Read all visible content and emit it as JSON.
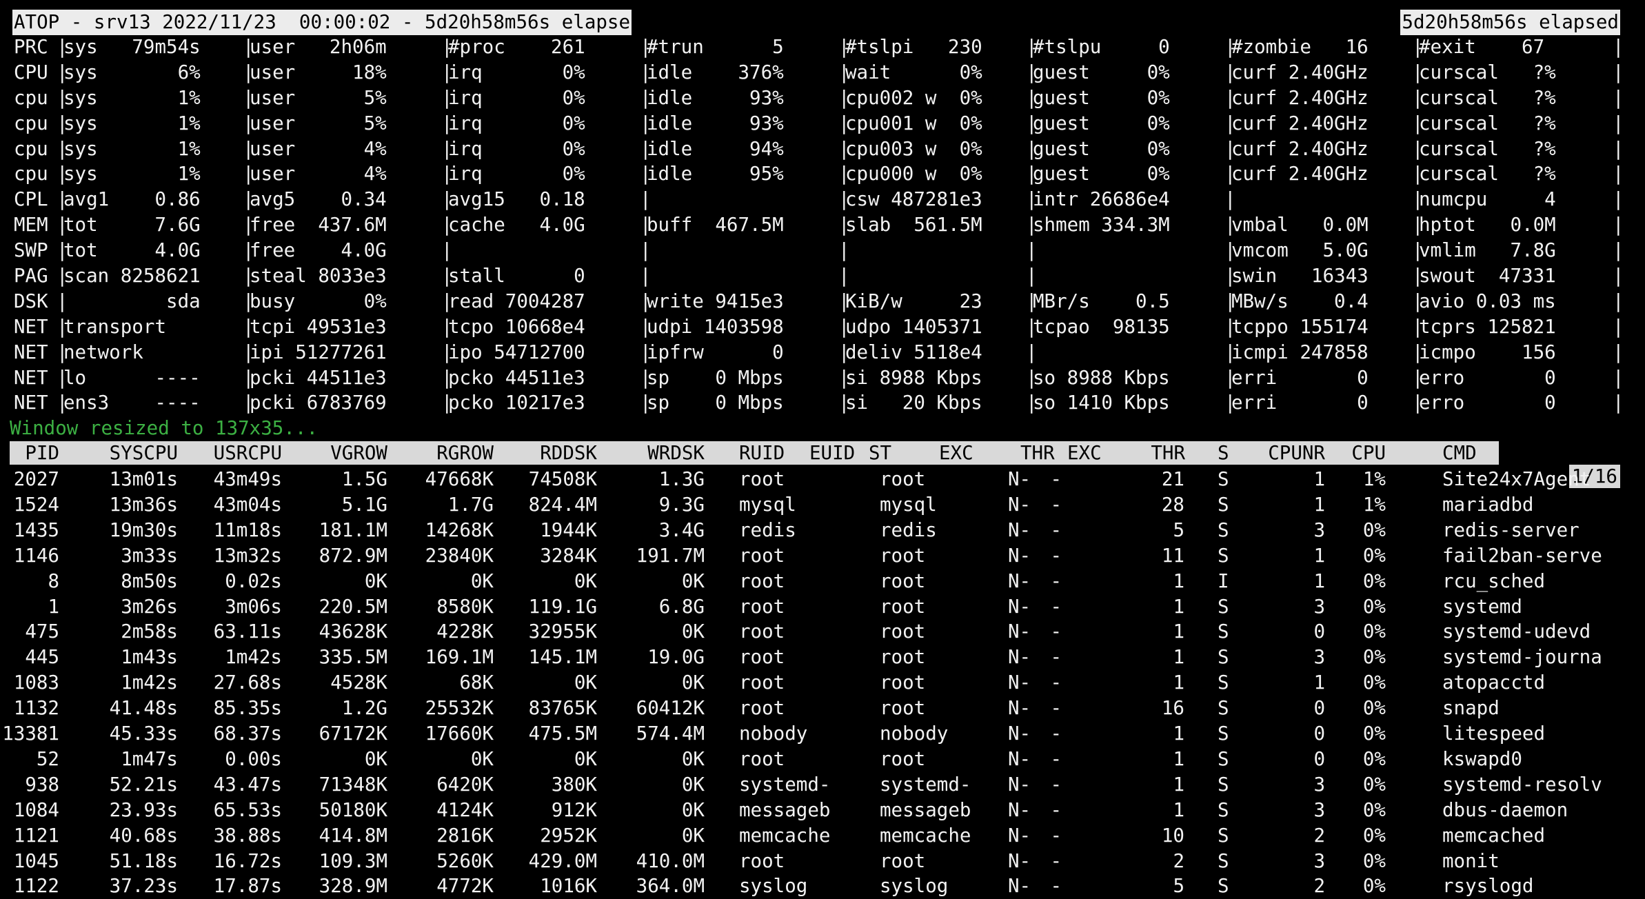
{
  "title": {
    "left": "ATOP - srv13 2022/11/23  00:00:02 - 5d20h58m56s elapse",
    "right": "5d20h58m56s elapsed"
  },
  "system_rows": [
    [
      "PRC",
      "sys   79m54s",
      "user   2h06m",
      "#proc    261",
      "#trun      5",
      "#tslpi   230",
      "#tslpu     0",
      "#zombie   16",
      "#exit    67"
    ],
    [
      "CPU",
      "sys       6%",
      "user     18%",
      "irq       0%",
      "idle    376%",
      "wait      0%",
      "guest     0%",
      "curf 2.40GHz",
      "curscal   ?%"
    ],
    [
      "cpu",
      "sys       1%",
      "user      5%",
      "irq       0%",
      "idle     93%",
      "cpu002 w  0%",
      "guest     0%",
      "curf 2.40GHz",
      "curscal   ?%"
    ],
    [
      "cpu",
      "sys       1%",
      "user      5%",
      "irq       0%",
      "idle     93%",
      "cpu001 w  0%",
      "guest     0%",
      "curf 2.40GHz",
      "curscal   ?%"
    ],
    [
      "cpu",
      "sys       1%",
      "user      4%",
      "irq       0%",
      "idle     94%",
      "cpu003 w  0%",
      "guest     0%",
      "curf 2.40GHz",
      "curscal   ?%"
    ],
    [
      "cpu",
      "sys       1%",
      "user      4%",
      "irq       0%",
      "idle     95%",
      "cpu000 w  0%",
      "guest     0%",
      "curf 2.40GHz",
      "curscal   ?%"
    ],
    [
      "CPL",
      "avg1    0.86",
      "avg5    0.34",
      "avg15   0.18",
      "",
      "csw 487281e3",
      "intr 26686e4",
      "",
      "numcpu     4"
    ],
    [
      "MEM",
      "tot     7.6G",
      "free  437.6M",
      "cache   4.0G",
      "buff  467.5M",
      "slab  561.5M",
      "shmem 334.3M",
      "vmbal   0.0M",
      "hptot   0.0M"
    ],
    [
      "SWP",
      "tot     4.0G",
      "free    4.0G",
      "",
      "",
      "",
      "",
      "vmcom   5.0G",
      "vmlim   7.8G"
    ],
    [
      "PAG",
      "scan 8258621",
      "steal 8033e3",
      "stall      0",
      "",
      "",
      "",
      "swin   16343",
      "swout  47331"
    ],
    [
      "DSK",
      "         sda",
      "busy      0%",
      "read 7004287",
      "write 9415e3",
      "KiB/w     23",
      "MBr/s    0.5",
      "MBw/s    0.4",
      "avio 0.03 ms"
    ],
    [
      "NET",
      "transport   ",
      "tcpi 49531e3",
      "tcpo 10668e4",
      "udpi 1403598",
      "udpo 1405371",
      "tcpao  98135",
      "tcppo 155174",
      "tcprs 125821"
    ],
    [
      "NET",
      "network     ",
      "ipi 51277261",
      "ipo 54712700",
      "ipfrw      0",
      "deliv 5118e4",
      "",
      "icmpi 247858",
      "icmpo    156"
    ],
    [
      "NET",
      "lo      ----",
      "pcki 44511e3",
      "pcko 44511e3",
      "sp    0 Mbps",
      "si 8988 Kbps",
      "so 8988 Kbps",
      "erri       0",
      "erro       0"
    ],
    [
      "NET",
      "ens3    ----",
      "pcki 6783769",
      "pcko 10217e3",
      "sp    0 Mbps",
      "si   20 Kbps",
      "so 1410 Kbps",
      "erri       0",
      "erro       0"
    ]
  ],
  "message": "Window resized to 137x35...",
  "process_header": [
    "PID",
    "SYSCPU",
    "USRCPU",
    "VGROW",
    "RGROW",
    "RDDSK",
    "WRDSK",
    "RUID",
    "EUID",
    "ST",
    "EXC",
    "THR",
    "EXC",
    "THR",
    "S",
    "CPUNR",
    "CPU",
    "CMD"
  ],
  "pager": "1/16",
  "processes": [
    [
      "2027",
      "13m01s",
      "43m49s",
      "1.5G",
      "47668K",
      "74508K",
      "1.3G",
      "root",
      "root",
      "N-",
      "-",
      "21",
      "S",
      "1",
      "1%",
      "Site24x7Agent"
    ],
    [
      "1524",
      "13m36s",
      "43m04s",
      "5.1G",
      "1.7G",
      "824.4M",
      "9.3G",
      "mysql",
      "mysql",
      "N-",
      "-",
      "28",
      "S",
      "1",
      "1%",
      "mariadbd"
    ],
    [
      "1435",
      "19m30s",
      "11m18s",
      "181.1M",
      "14268K",
      "1944K",
      "3.4G",
      "redis",
      "redis",
      "N-",
      "-",
      "5",
      "S",
      "3",
      "0%",
      "redis-server"
    ],
    [
      "1146",
      "3m33s",
      "13m32s",
      "872.9M",
      "23840K",
      "3284K",
      "191.7M",
      "root",
      "root",
      "N-",
      "-",
      "11",
      "S",
      "1",
      "0%",
      "fail2ban-serve"
    ],
    [
      "8",
      "8m50s",
      "0.02s",
      "0K",
      "0K",
      "0K",
      "0K",
      "root",
      "root",
      "N-",
      "-",
      "1",
      "I",
      "1",
      "0%",
      "rcu_sched"
    ],
    [
      "1",
      "3m26s",
      "3m06s",
      "220.5M",
      "8580K",
      "119.1G",
      "6.8G",
      "root",
      "root",
      "N-",
      "-",
      "1",
      "S",
      "3",
      "0%",
      "systemd"
    ],
    [
      "475",
      "2m58s",
      "63.11s",
      "43628K",
      "4228K",
      "32955K",
      "0K",
      "root",
      "root",
      "N-",
      "-",
      "1",
      "S",
      "0",
      "0%",
      "systemd-udevd"
    ],
    [
      "445",
      "1m43s",
      "1m42s",
      "335.5M",
      "169.1M",
      "145.1M",
      "19.0G",
      "root",
      "root",
      "N-",
      "-",
      "1",
      "S",
      "3",
      "0%",
      "systemd-journa"
    ],
    [
      "1083",
      "1m42s",
      "27.68s",
      "4528K",
      "68K",
      "0K",
      "0K",
      "root",
      "root",
      "N-",
      "-",
      "1",
      "S",
      "1",
      "0%",
      "atopacctd"
    ],
    [
      "1132",
      "41.48s",
      "85.35s",
      "1.2G",
      "25532K",
      "83765K",
      "60412K",
      "root",
      "root",
      "N-",
      "-",
      "16",
      "S",
      "0",
      "0%",
      "snapd"
    ],
    [
      "13381",
      "45.33s",
      "68.37s",
      "67172K",
      "17660K",
      "475.5M",
      "574.4M",
      "nobody",
      "nobody",
      "N-",
      "-",
      "1",
      "S",
      "0",
      "0%",
      "litespeed"
    ],
    [
      "52",
      "1m47s",
      "0.00s",
      "0K",
      "0K",
      "0K",
      "0K",
      "root",
      "root",
      "N-",
      "-",
      "1",
      "S",
      "0",
      "0%",
      "kswapd0"
    ],
    [
      "938",
      "52.21s",
      "43.47s",
      "71348K",
      "6420K",
      "380K",
      "0K",
      "systemd-",
      "systemd-",
      "N-",
      "-",
      "1",
      "S",
      "3",
      "0%",
      "systemd-resolv"
    ],
    [
      "1084",
      "23.93s",
      "65.53s",
      "50180K",
      "4124K",
      "912K",
      "0K",
      "messageb",
      "messageb",
      "N-",
      "-",
      "1",
      "S",
      "3",
      "0%",
      "dbus-daemon"
    ],
    [
      "1121",
      "40.68s",
      "38.88s",
      "414.8M",
      "2816K",
      "2952K",
      "0K",
      "memcache",
      "memcache",
      "N-",
      "-",
      "10",
      "S",
      "2",
      "0%",
      "memcached"
    ],
    [
      "1045",
      "51.18s",
      "16.72s",
      "109.3M",
      "5260K",
      "429.0M",
      "410.0M",
      "root",
      "root",
      "N-",
      "-",
      "2",
      "S",
      "3",
      "0%",
      "monit"
    ],
    [
      "1122",
      "37.23s",
      "17.87s",
      "328.9M",
      "4772K",
      "1016K",
      "364.0M",
      "syslog",
      "syslog",
      "N-",
      "-",
      "5",
      "S",
      "2",
      "0%",
      "rsyslogd"
    ]
  ]
}
